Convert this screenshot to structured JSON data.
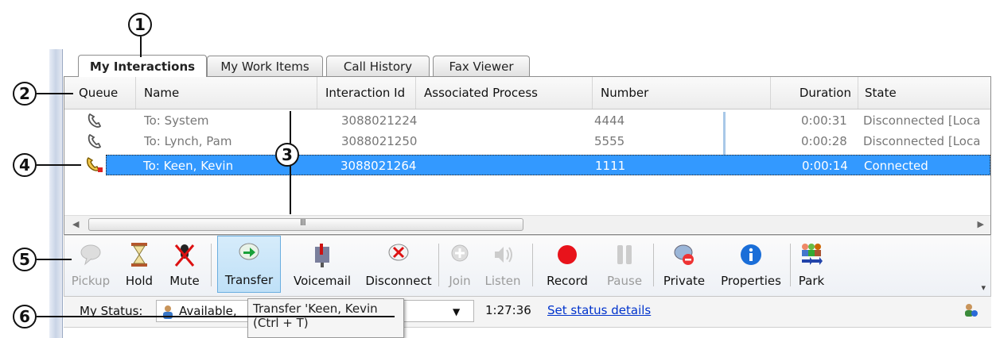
{
  "callouts": [
    "1",
    "2",
    "3",
    "4",
    "5",
    "6"
  ],
  "tabs": [
    {
      "label": "My Interactions",
      "active": true
    },
    {
      "label": "My Work Items",
      "active": false
    },
    {
      "label": "Call History",
      "active": false
    },
    {
      "label": "Fax Viewer",
      "active": false
    }
  ],
  "columns": [
    "Queue",
    "Name",
    "Interaction Id",
    "Associated Process",
    "Number",
    "Duration",
    "State"
  ],
  "rows": [
    {
      "icon": "phone-disconnected-icon",
      "name": "To: System",
      "id": "3088021224",
      "process": "",
      "number": "4444",
      "duration": "0:00:31",
      "state": "Disconnected [Loca"
    },
    {
      "icon": "phone-disconnected-icon",
      "name": "To: Lynch, Pam",
      "id": "3088021250",
      "process": "",
      "number": "5555",
      "duration": "0:00:28",
      "state": "Disconnected [Loca"
    },
    {
      "icon": "phone-connected-icon",
      "name": "To: Keen, Kevin",
      "id": "3088021264",
      "process": "",
      "number": "1111",
      "duration": "0:00:14",
      "state": "Connected",
      "selected": true
    }
  ],
  "scroll_thumb_label": "III",
  "toolbar": {
    "pickup": "Pickup",
    "hold": "Hold",
    "mute": "Mute",
    "transfer": "Transfer",
    "voicemail": "Voicemail",
    "disconnect": "Disconnect",
    "join": "Join",
    "listen": "Listen",
    "record": "Record",
    "pause": "Pause",
    "private": "Private",
    "properties": "Properties",
    "park": "Park"
  },
  "status": {
    "label": "My Status:",
    "value": "Available,",
    "time": "1:27:36",
    "details_link": "Set status details"
  },
  "tooltip": {
    "line1": "Transfer 'Keen, Kevin",
    "line2": "(Ctrl + T)"
  },
  "colors": {
    "selection": "#3399ff",
    "record": "#e8131b",
    "link": "#0033cc"
  }
}
